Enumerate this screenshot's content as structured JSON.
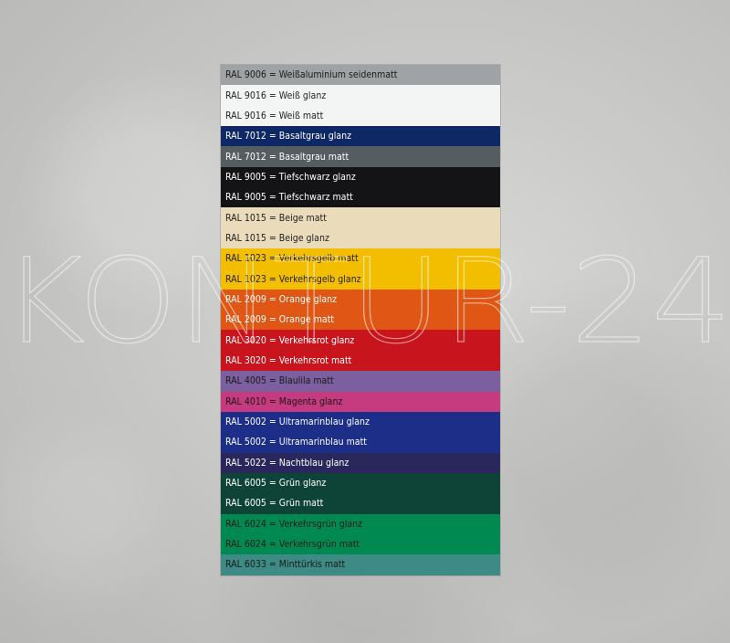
{
  "watermark": {
    "text": "KONTUR-24"
  },
  "swatches": [
    {
      "label": "RAL 9006 = Weißaluminium seidenmatt",
      "color": "#a0a3a5",
      "text_color": "#1a1a1a"
    },
    {
      "label": "RAL 9016 = Weiß glanz",
      "color": "#f3f5f4",
      "text_color": "#222222"
    },
    {
      "label": "RAL 9016 = Weiß matt",
      "color": "#f3f5f4",
      "text_color": "#222222"
    },
    {
      "label": "RAL 7012 = Basaltgrau glanz",
      "color": "#0e2765",
      "text_color": "#ffffff"
    },
    {
      "label": "RAL 7012 = Basaltgrau matt",
      "color": "#565d60",
      "text_color": "#ffffff"
    },
    {
      "label": "RAL 9005 = Tiefschwarz glanz",
      "color": "#141416",
      "text_color": "#ffffff"
    },
    {
      "label": "RAL 9005 = Tiefschwarz matt",
      "color": "#141416",
      "text_color": "#ffffff"
    },
    {
      "label": "RAL 1015 = Beige matt",
      "color": "#eadbbb",
      "text_color": "#222222"
    },
    {
      "label": "RAL 1015 = Beige glanz",
      "color": "#eadbbb",
      "text_color": "#222222"
    },
    {
      "label": "RAL 1023 = Verkehrsgelb matt",
      "color": "#f3be00",
      "text_color": "#222222"
    },
    {
      "label": "RAL 1023 = Verkehrsgelb glanz",
      "color": "#f3be00",
      "text_color": "#222222"
    },
    {
      "label": "RAL 2009 = Orange glanz",
      "color": "#e05614",
      "text_color": "#ffffff"
    },
    {
      "label": "RAL 2009 = Orange matt",
      "color": "#e05614",
      "text_color": "#ffffff"
    },
    {
      "label": "RAL 3020 = Verkehrsrot glanz",
      "color": "#c8141c",
      "text_color": "#ffffff"
    },
    {
      "label": "RAL 3020 = Verkehrsrot matt",
      "color": "#c8141c",
      "text_color": "#ffffff"
    },
    {
      "label": "RAL 4005 = Blaulila matt",
      "color": "#7b5f9f",
      "text_color": "#1a1a1a"
    },
    {
      "label": "RAL 4010 = Magenta glanz",
      "color": "#c63a80",
      "text_color": "#1a1a1a"
    },
    {
      "label": "RAL 5002 = Ultramarinblau glanz",
      "color": "#1d2e88",
      "text_color": "#ffffff"
    },
    {
      "label": "RAL 5002 = Ultramarinblau matt",
      "color": "#1d2e88",
      "text_color": "#ffffff"
    },
    {
      "label": "RAL 5022 = Nachtblau glanz",
      "color": "#2a275c",
      "text_color": "#ffffff"
    },
    {
      "label": "RAL 6005 = Grün glanz",
      "color": "#0d4437",
      "text_color": "#ffffff"
    },
    {
      "label": "RAL 6005 = Grün matt",
      "color": "#0d4437",
      "text_color": "#ffffff"
    },
    {
      "label": "RAL 6024 = Verkehrsgrün glanz",
      "color": "#008a52",
      "text_color": "#1a1a1a"
    },
    {
      "label": "RAL 6024 = Verkehrsgrün matt",
      "color": "#008a52",
      "text_color": "#1a1a1a"
    },
    {
      "label": "RAL 6033 = Minttürkis matt",
      "color": "#3e8a84",
      "text_color": "#1a1a1a"
    }
  ]
}
